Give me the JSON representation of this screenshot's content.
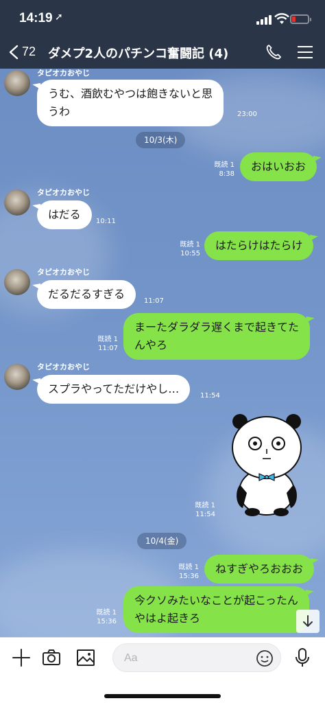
{
  "status_bar": {
    "time": "14:19",
    "location_glyph": "➚"
  },
  "header": {
    "back_count": "72",
    "title": "ダメプ2人のパチンコ奮闘記 (4)",
    "icons": [
      "back-chevron-icon",
      "phone-icon",
      "menu-icon"
    ]
  },
  "messages": [
    {
      "type": "in",
      "sender": "タピオカおやじ",
      "lines": [
        "うむ、酒飲むやつは飽きないと思",
        "うわ"
      ],
      "time": "23:00"
    },
    {
      "type": "date",
      "label": "10/3(木)"
    },
    {
      "type": "out",
      "text": "おはいおお",
      "read": "既読 1",
      "time": "8:38"
    },
    {
      "type": "in",
      "sender": "タピオカおやじ",
      "text": "はだる",
      "time": "10:11"
    },
    {
      "type": "out",
      "text": "はたらけはたらけ",
      "read": "既読 1",
      "time": "10:55"
    },
    {
      "type": "in",
      "sender": "タピオカおやじ",
      "text": "だるだるすぎる",
      "time": "11:07"
    },
    {
      "type": "out",
      "lines": [
        "まーたダラダラ遅くまで起きてた",
        "んやろ"
      ],
      "read": "既読 1",
      "time": "11:07"
    },
    {
      "type": "in",
      "sender": "タピオカおやじ",
      "text": "スプラやってただけやし…",
      "time": "11:54"
    },
    {
      "type": "sticker",
      "sticker": "panda-sticker",
      "read": "既読 1",
      "time": "11:54"
    },
    {
      "type": "date",
      "label": "10/4(金)"
    },
    {
      "type": "out",
      "text": "ねすぎやろおおお",
      "read": "既読 1",
      "time": "15:36"
    },
    {
      "type": "out",
      "lines": [
        "今クソみたいなことが起こったん",
        "やはよ起きろ"
      ],
      "read": "既読 1",
      "time": "15:36"
    }
  ],
  "input": {
    "placeholder": "Aa",
    "icons": [
      "plus-icon",
      "camera-icon",
      "image-icon",
      "emoji-icon",
      "microphone-icon"
    ]
  },
  "colors": {
    "header_bg": "#2b3548",
    "outgoing_bubble": "#85e249",
    "incoming_bubble": "#ffffff",
    "chat_bg": "#7294c8",
    "battery_low": "#e5322d"
  }
}
